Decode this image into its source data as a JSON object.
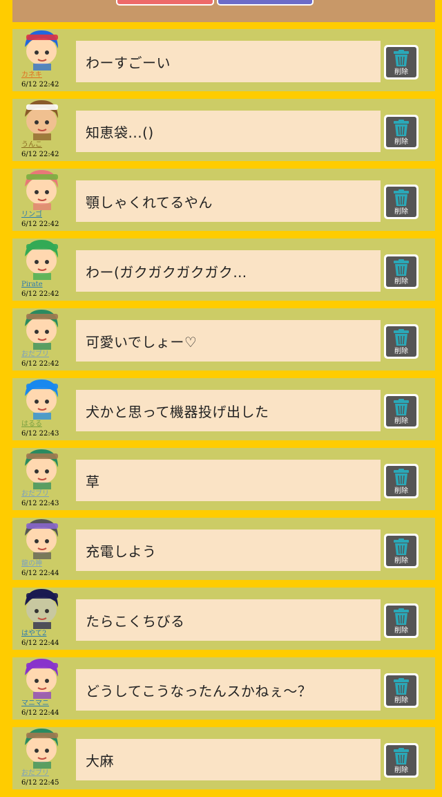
{
  "accent": {
    "background": "#ffcc00",
    "row": "#cccc66",
    "bubble": "#fae3c5",
    "topbar": "#c89868"
  },
  "delete_label": "削除",
  "messages": [
    {
      "user": "カネキ",
      "user_color": "#e07020",
      "time": "6/12 22:42",
      "text": "わーすごーい",
      "hair": "#2266dd",
      "hat": "#dd3344",
      "skin": "#ffd8b0"
    },
    {
      "user": "うんこ",
      "user_color": "#8a6a20",
      "time": "6/12 22:42",
      "text": "知恵袋...()",
      "hair": "#8a5a2a",
      "hat": "#ffffff",
      "skin": "#f0c090"
    },
    {
      "user": "リンゴ",
      "user_color": "#2a7ab0",
      "time": "6/12 22:42",
      "text": "顎しゃくれてるやん",
      "hair": "#e87878",
      "hat": "#7ab040",
      "skin": "#ffd8b0"
    },
    {
      "user": "Pirate",
      "user_color": "#2a7ab0",
      "time": "6/12 22:42",
      "text": "わー(ガクガクガクガク…",
      "hair": "#33aa55",
      "hat": "#33aa55",
      "skin": "#ffd8b0"
    },
    {
      "user": "おだブリ",
      "user_color": "#7aa0c0",
      "time": "6/12 22:42",
      "text": "可愛いでしょー♡",
      "hair": "#2a8a60",
      "hat": "#a07850",
      "skin": "#ffd8b0"
    },
    {
      "user": "はるる",
      "user_color": "#7aa040",
      "time": "6/12 22:43",
      "text": "犬かと思って機器投げ出した",
      "hair": "#1a88ee",
      "hat": "#1a88ee",
      "skin": "#ffd8b0"
    },
    {
      "user": "おだブリ",
      "user_color": "#7aa0c0",
      "time": "6/12 22:43",
      "text": "草",
      "hair": "#2a8a60",
      "hat": "#a07850",
      "skin": "#ffd8b0"
    },
    {
      "user": "龍の神",
      "user_color": "#7aa0c0",
      "time": "6/12 22:44",
      "text": "充電しよう",
      "hair": "#555555",
      "hat": "#8866cc",
      "skin": "#ffd8b0"
    },
    {
      "user": "はやて2",
      "user_color": "#2a7ab0",
      "time": "6/12 22:44",
      "text": "たらこくちびる",
      "hair": "#1a1a50",
      "hat": "#1a1a50",
      "skin": "#c8c8a0"
    },
    {
      "user": "マニマニ",
      "user_color": "#2a7ab0",
      "time": "6/12 22:44",
      "text": "どうしてこうなったんスかねぇ〜？",
      "hair": "#8833cc",
      "hat": "#8833cc",
      "skin": "#ffd8b0"
    },
    {
      "user": "おだブリ",
      "user_color": "#7aa0c0",
      "time": "6/12 22:45",
      "text": "大麻",
      "hair": "#2a8a60",
      "hat": "#a07850",
      "skin": "#ffd8b0"
    }
  ]
}
